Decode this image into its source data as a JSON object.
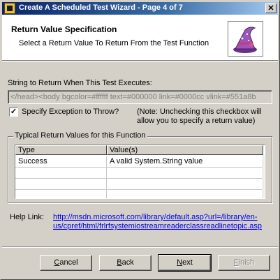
{
  "window": {
    "title": "Create A Scheduled Test Wizard - Page 4 of 7",
    "close_glyph": "✕"
  },
  "header": {
    "title": "Return Value Specification",
    "subtitle": "Select a Return Value To Return From the Test Function",
    "image_icon": "wizard-hat-icon"
  },
  "return_string": {
    "label": "String to Return When This Test Executes:",
    "value": "</head><body bgcolor=#ffffff text=#000000 link=#0000cc vlink=#551a8b"
  },
  "exception": {
    "checkbox_label": "Specify Exception to Throw?",
    "checked": true,
    "check_glyph": "✓",
    "note": "(Note: Unchecking this checkbox will allow you to specify a return value)"
  },
  "typical_values": {
    "caption": "Typical Return Values for this Function",
    "columns": [
      "Type",
      "Value(s)"
    ],
    "rows": [
      {
        "type": "Success",
        "value": "A valid System.String value"
      }
    ]
  },
  "help": {
    "label": "Help Link:",
    "url_line1": "http://msdn.microsoft.com/library/default.asp?url=/library/en-",
    "url_line2": "us/cpref/html/frlrfsystemiostreamreaderclassreadlinetopic.asp"
  },
  "buttons": {
    "cancel": {
      "first": "C",
      "rest": "ancel"
    },
    "back": {
      "first": "B",
      "rest": "ack"
    },
    "next": {
      "first": "N",
      "rest": "ext"
    },
    "finish": {
      "first": "F",
      "rest": "inish"
    }
  },
  "colors": {
    "title_bar_start": "#0a246a",
    "title_bar_end": "#a6caf0",
    "face": "#d4d0c8",
    "link": "#0000ee"
  }
}
